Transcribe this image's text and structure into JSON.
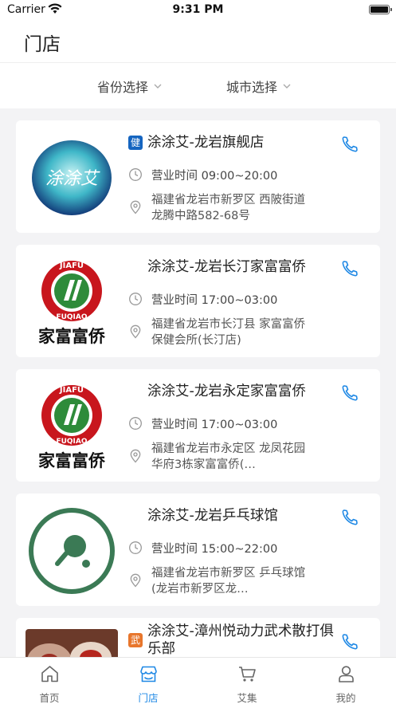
{
  "status_bar": {
    "carrier": "Carrier",
    "time": "9:31 PM"
  },
  "header": {
    "title": "门店"
  },
  "filters": {
    "province": "省份选择",
    "city": "城市选择"
  },
  "colors": {
    "accent": "#1e88e5",
    "tag_blue": "#1565c0",
    "tag_orange": "#e8762c"
  },
  "stores": [
    {
      "name": "涂涂艾-龙岩旗舰店",
      "tag": "健",
      "hours": "营业时间 09:00~20:00",
      "address": "福建省龙岩市新罗区 西陂街道龙腾中路582-68号",
      "logo_text": "涂涂艾",
      "logo": "tutuai-logo"
    },
    {
      "name": "涂涂艾-龙岩长汀家富富侨",
      "tag": "",
      "hours": "营业时间 17:00~03:00",
      "address": "福建省龙岩市长汀县 家富富侨保健会所(长汀店)",
      "logo_text": "家富富侨",
      "logo_arc_top": "JIAFU",
      "logo_arc_bottom": "FUQIAO",
      "logo": "jiafu-fuqiao-logo"
    },
    {
      "name": "涂涂艾-龙岩永定家富富侨",
      "tag": "",
      "hours": "营业时间 17:00~03:00",
      "address": "福建省龙岩市永定区 龙凤花园华府3栋家富富侨(…",
      "logo_text": "家富富侨",
      "logo_arc_top": "JIAFU",
      "logo_arc_bottom": "FUQIAO",
      "logo": "jiafu-fuqiao-logo"
    },
    {
      "name": "涂涂艾-龙岩乒乓球馆",
      "tag": "",
      "hours": "营业时间 15:00~22:00",
      "address": "福建省龙岩市新罗区 乒乓球馆(龙岩市新罗区龙…",
      "logo": "ping-pong-logo"
    },
    {
      "name": "涂涂艾-漳州悦动力武术散打俱乐部",
      "tag": "武",
      "logo": "martial-arts-photo"
    }
  ],
  "tabs": [
    {
      "label": "首页",
      "icon": "home-icon",
      "active": false
    },
    {
      "label": "门店",
      "icon": "store-icon",
      "active": true
    },
    {
      "label": "艾集",
      "icon": "cart-icon",
      "active": false
    },
    {
      "label": "我的",
      "icon": "user-icon",
      "active": false
    }
  ]
}
